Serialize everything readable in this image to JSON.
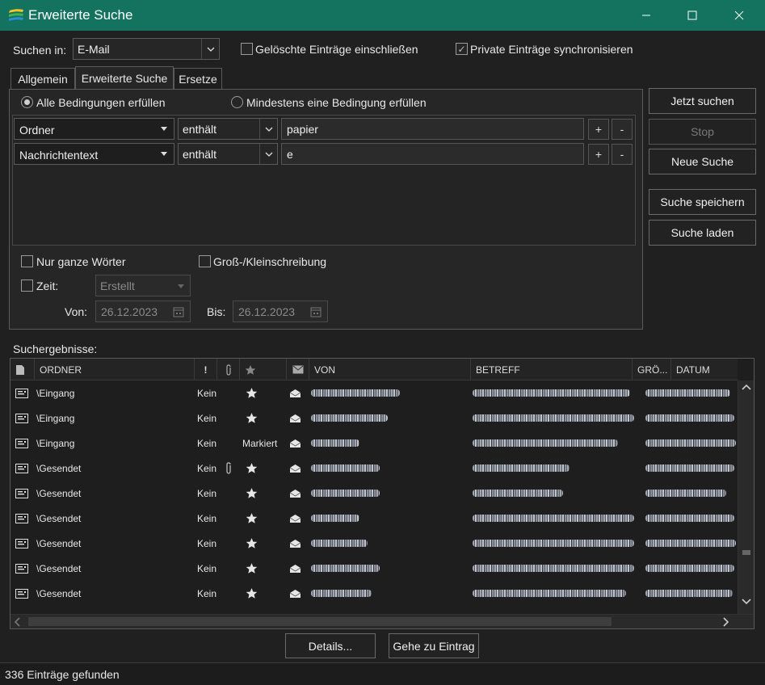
{
  "window": {
    "title": "Erweiterte Suche"
  },
  "search_in": {
    "label": "Suchen in:",
    "value": "E-Mail"
  },
  "options": {
    "include_deleted": {
      "label": "Gelöschte Einträge einschließen",
      "checked": false
    },
    "sync_private": {
      "label": "Private Einträge synchronisieren",
      "checked": true
    }
  },
  "tabs": [
    {
      "label": "Allgemein",
      "active": false
    },
    {
      "label": "Erweiterte Suche",
      "active": true
    },
    {
      "label": "Ersetze",
      "active": false
    }
  ],
  "match": {
    "all": {
      "label": "Alle Bedingungen erfüllen",
      "selected": true
    },
    "any": {
      "label": "Mindestens eine Bedingung erfüllen",
      "selected": false
    }
  },
  "conditions": [
    {
      "field": "Ordner",
      "operator": "enthält",
      "value": "papier"
    },
    {
      "field": "Nachrichtentext",
      "operator": "enthält",
      "value": "e"
    }
  ],
  "condition_buttons": {
    "add": "+",
    "remove": "-"
  },
  "filters": {
    "whole_words": {
      "label": "Nur ganze Wörter",
      "checked": false
    },
    "case_sensitive": {
      "label": "Groß-/Kleinschreibung",
      "checked": false
    },
    "time": {
      "label": "Zeit:",
      "checked": false,
      "type": "Erstellt"
    },
    "from": {
      "label": "Von:",
      "value": "26.12.2023"
    },
    "to": {
      "label": "Bis:",
      "value": "26.12.2023"
    }
  },
  "actions": {
    "search_now": "Jetzt suchen",
    "stop": "Stop",
    "new_search": "Neue Suche",
    "save_search": "Suche speichern",
    "load_search": "Suche laden"
  },
  "results": {
    "label": "Suchergebnisse:",
    "columns": [
      "ORDNER",
      "!",
      "VON",
      "BETREFF",
      "GRÖ...",
      "DATUM"
    ],
    "rows": [
      {
        "folder": "\\Eingang",
        "priority": "Kein",
        "attachment": false,
        "flag": "star"
      },
      {
        "folder": "\\Eingang",
        "priority": "Kein",
        "attachment": false,
        "flag": "star"
      },
      {
        "folder": "\\Eingang",
        "priority": "Kein",
        "attachment": false,
        "flag": "Markiert"
      },
      {
        "folder": "\\Gesendet",
        "priority": "Kein",
        "attachment": true,
        "flag": "star"
      },
      {
        "folder": "\\Gesendet",
        "priority": "Kein",
        "attachment": false,
        "flag": "star"
      },
      {
        "folder": "\\Gesendet",
        "priority": "Kein",
        "attachment": false,
        "flag": "star"
      },
      {
        "folder": "\\Gesendet",
        "priority": "Kein",
        "attachment": false,
        "flag": "star"
      },
      {
        "folder": "\\Gesendet",
        "priority": "Kein",
        "attachment": false,
        "flag": "star"
      },
      {
        "folder": "\\Gesendet",
        "priority": "Kein",
        "attachment": false,
        "flag": "star"
      }
    ]
  },
  "bottom_buttons": {
    "details": "Details...",
    "goto": "Gehe zu Eintrag"
  },
  "status": "336 Einträge gefunden",
  "colors": {
    "titlebar": "#14735f",
    "background": "#202020"
  }
}
